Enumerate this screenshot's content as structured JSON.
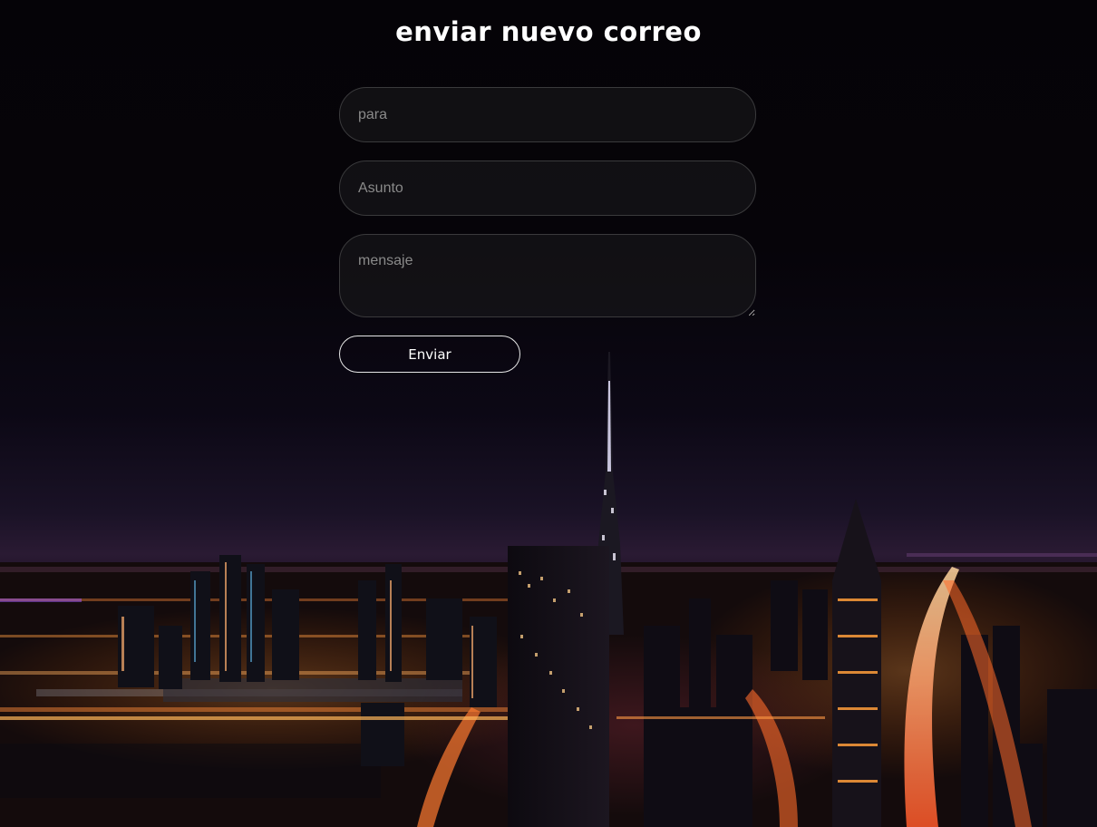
{
  "page": {
    "title": "enviar nuevo correo"
  },
  "form": {
    "to_placeholder": "para",
    "to_value": "",
    "subject_placeholder": "Asunto",
    "subject_value": "",
    "message_placeholder": "mensaje",
    "message_value": "",
    "send_label": "Enviar"
  },
  "colors": {
    "text": "#ffffff",
    "field_border": "#3a3a3c",
    "button_border": "#e6e6e6"
  }
}
